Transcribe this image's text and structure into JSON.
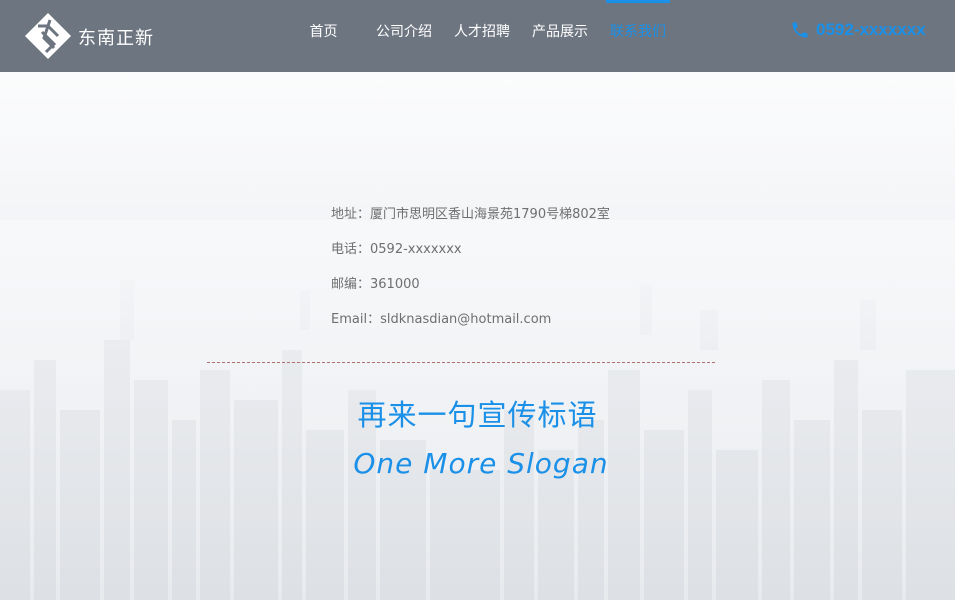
{
  "brand": {
    "name": "东南正新",
    "logo_icon": "diamond-logo-icon"
  },
  "nav": {
    "items": [
      {
        "label": "首页",
        "active": false
      },
      {
        "label": "公司介绍",
        "active": false
      },
      {
        "label": "人才招聘",
        "active": false
      },
      {
        "label": "产品展示",
        "active": false
      },
      {
        "label": "联系我们",
        "active": true
      }
    ]
  },
  "header": {
    "phone": "0592-xxxxxxx",
    "phone_icon": "phone-icon"
  },
  "contact": {
    "address": "地址：厦门市思明区香山海景苑1790号梯802室",
    "tel": "电话：0592-xxxxxxx",
    "postcode": "邮编：361000",
    "email": "Email：sldknasdian@hotmail.com"
  },
  "slogan": {
    "cn": "再来一句宣传标语",
    "en": "One More Slogan"
  },
  "colors": {
    "accent": "#1a90e8",
    "header_bg": "#6d7680",
    "text": "#6f6f6f"
  }
}
